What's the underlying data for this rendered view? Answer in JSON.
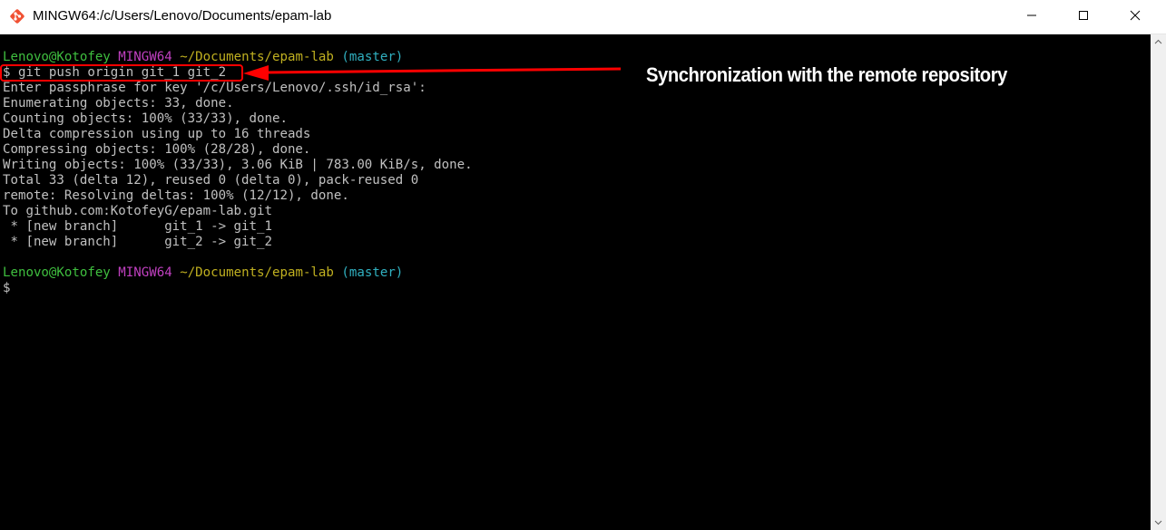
{
  "window": {
    "title": "MINGW64:/c/Users/Lenovo/Documents/epam-lab",
    "app_icon": "git-icon",
    "controls": {
      "minimize_icon": "minimize-icon",
      "maximize_icon": "maximize-icon",
      "close_icon": "close-icon"
    }
  },
  "terminal": {
    "prompt1": {
      "user": "Lenovo@Kotofey",
      "system": "MINGW64",
      "path": "~/Documents/epam-lab",
      "branch": "(master)"
    },
    "command": "$ git push origin git_1 git_2",
    "output": [
      "Enter passphrase for key '/c/Users/Lenovo/.ssh/id_rsa':",
      "Enumerating objects: 33, done.",
      "Counting objects: 100% (33/33), done.",
      "Delta compression using up to 16 threads",
      "Compressing objects: 100% (28/28), done.",
      "Writing objects: 100% (33/33), 3.06 KiB | 783.00 KiB/s, done.",
      "Total 33 (delta 12), reused 0 (delta 0), pack-reused 0",
      "remote: Resolving deltas: 100% (12/12), done.",
      "To github.com:KotofeyG/epam-lab.git",
      " * [new branch]      git_1 -> git_1",
      " * [new branch]      git_2 -> git_2"
    ],
    "prompt2": {
      "user": "Lenovo@Kotofey",
      "system": "MINGW64",
      "path": "~/Documents/epam-lab",
      "branch": "(master)"
    },
    "cursor_prompt": "$"
  },
  "annotation": {
    "text": "Synchronization with the remote repository",
    "color": "#ff0000"
  },
  "colors": {
    "user": "#3fbf3f",
    "system": "#c040c0",
    "path": "#c0b020",
    "branch": "#30b0c0",
    "text": "#c0c0c0",
    "background": "#000000"
  }
}
